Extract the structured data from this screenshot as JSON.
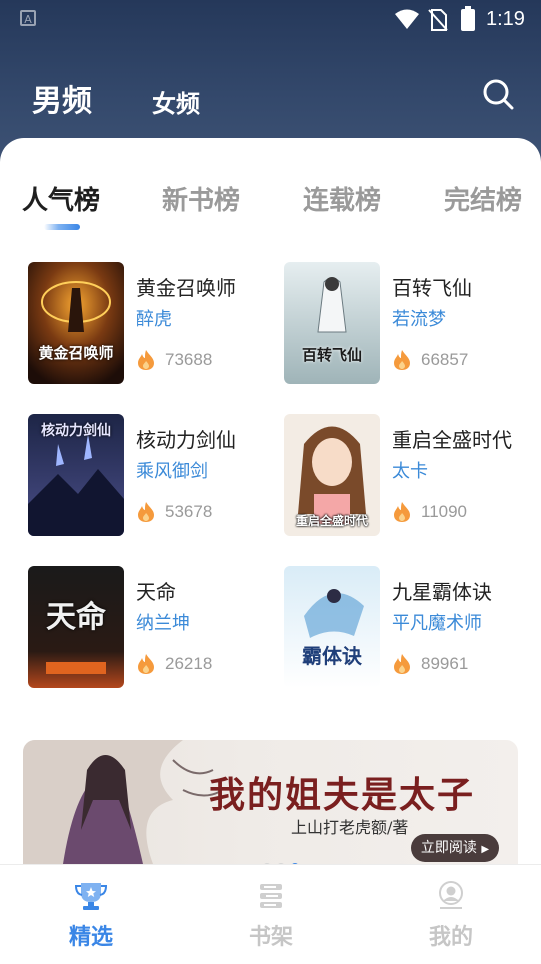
{
  "status_bar": {
    "time": "1:19",
    "notification_icon": "A"
  },
  "header": {
    "tabs": [
      {
        "label": "男频",
        "active": true
      },
      {
        "label": "女频",
        "active": false
      }
    ],
    "search_icon": "search-icon"
  },
  "rank_tabs": [
    {
      "label": "人气榜",
      "active": true
    },
    {
      "label": "新书榜",
      "active": false
    },
    {
      "label": "连载榜",
      "active": false
    },
    {
      "label": "完结榜",
      "active": false
    }
  ],
  "books": [
    {
      "title": "黄金召唤师",
      "author": "醉虎",
      "count": "73688",
      "cover_text": "黄金召唤师"
    },
    {
      "title": "百转飞仙",
      "author": "若流梦",
      "count": "66857",
      "cover_text": "百转飞仙"
    },
    {
      "title": "核动力剑仙",
      "author": "乘风御剑",
      "count": "53678",
      "cover_text": "核动力剑仙"
    },
    {
      "title": "重启全盛时代",
      "author": "太卡",
      "count": "11090",
      "cover_text": "重启全盛时代"
    },
    {
      "title": "天命",
      "author": "纳兰坤",
      "count": "26218",
      "cover_text": "天命"
    },
    {
      "title": "九星霸体诀",
      "author": "平凡魔术师",
      "count": "89961",
      "cover_text": "霸体诀"
    }
  ],
  "banner": {
    "title": "我的姐夫是太子",
    "subtitle": "上山打老虎额/著",
    "button": "立即阅读"
  },
  "bottom_nav": [
    {
      "label": "精选",
      "active": true,
      "icon": "trophy-icon"
    },
    {
      "label": "书架",
      "active": false,
      "icon": "bookshelf-icon"
    },
    {
      "label": "我的",
      "active": false,
      "icon": "profile-icon"
    }
  ],
  "colors": {
    "accent": "#3a86e6",
    "header": "#2b3e60",
    "author": "#3b8ad8",
    "count": "#9a9a9a"
  }
}
